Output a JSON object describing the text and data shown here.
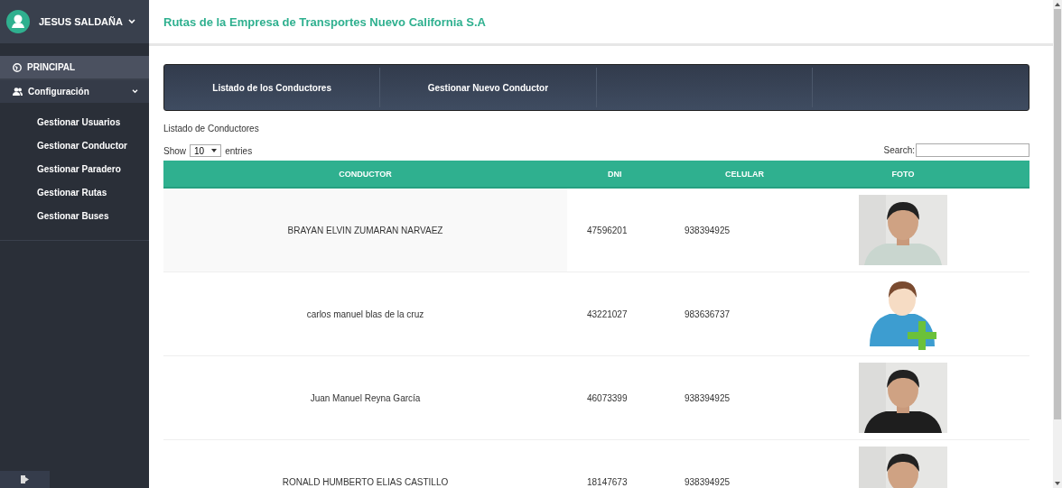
{
  "sidebar": {
    "user": {
      "name": "JESUS SALDAÑA"
    },
    "menu": [
      {
        "kind": "link",
        "label": "PRINCIPAL",
        "selected": true
      },
      {
        "kind": "group",
        "label": "Configuración",
        "selected": false,
        "expanded": true,
        "children": [
          {
            "label": "Gestionar Usuarios"
          },
          {
            "label": "Gestionar Conductor"
          },
          {
            "label": "Gestionar Paradero"
          },
          {
            "label": "Gestionar Rutas"
          },
          {
            "label": "Gestionar Buses"
          }
        ]
      }
    ]
  },
  "header": {
    "title": "Rutas de la Empresa de Transportes Nuevo California S.A"
  },
  "tabs": [
    {
      "label": "Listado de los Conductores"
    },
    {
      "label": "Gestionar Nuevo Conductor"
    }
  ],
  "section_title": "Listado de Conductores",
  "length_control": {
    "before": "Show",
    "value": "10",
    "after": "entries"
  },
  "search": {
    "label": "Search:"
  },
  "table": {
    "columns": [
      "CONDUCTOR",
      "DNI",
      "CELULAR",
      "FOTO"
    ],
    "rows": [
      {
        "name": "BRAYAN ELVIN ZUMARAN NARVAEZ",
        "dni": "47596201",
        "phone": "938394925"
      },
      {
        "name": "carlos manuel blas de la cruz",
        "dni": "43221027",
        "phone": "983636737",
        "photo": {
          "kind": "placeholder"
        }
      },
      {
        "name": "Juan Manuel Reyna García",
        "dni": "46073399",
        "phone": "938394925"
      },
      {
        "name": "RONALD HUMBERTO ELIAS CASTILLO",
        "dni": "18147673",
        "phone": "938394925"
      }
    ]
  }
}
